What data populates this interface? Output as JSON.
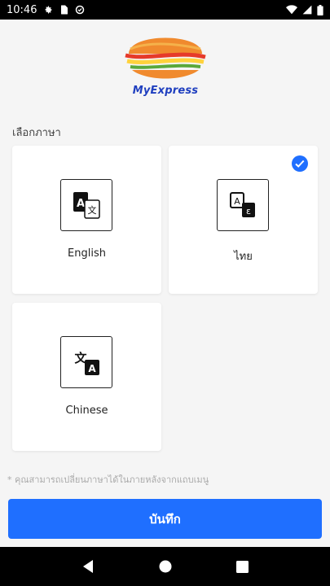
{
  "status_bar": {
    "time": "10:46",
    "left_icons": [
      "gear-icon",
      "sd-card-icon",
      "sync-icon"
    ],
    "right_icons": [
      "wifi-icon",
      "signal-icon",
      "battery-icon"
    ]
  },
  "logo": {
    "brand": "MyExpress"
  },
  "section_label": "เลือกภาษา",
  "languages": [
    {
      "name": "English",
      "icon": "translate-a-icon",
      "selected": false
    },
    {
      "name": "ไทย",
      "icon": "translate-thai-icon",
      "selected": true
    },
    {
      "name": "Chinese",
      "icon": "translate-chinese-icon",
      "selected": false
    }
  ],
  "note": "* คุณสามารถเปลี่ยนภาษาได้ในภายหลังจากแถบเมนู",
  "save_button": {
    "label": "บันทึก"
  },
  "accent_color": "#1f6fff",
  "nav_bar": {
    "buttons": [
      "back-icon",
      "home-icon",
      "recents-icon"
    ]
  }
}
